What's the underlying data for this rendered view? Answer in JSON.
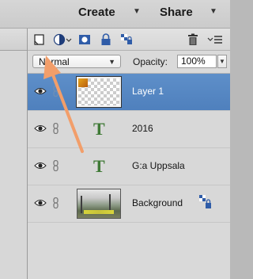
{
  "topbar": {
    "create_label": "Create",
    "share_label": "Share"
  },
  "panel": {
    "blend_mode": "Normal",
    "opacity_label": "Opacity:",
    "opacity_value": "100%",
    "layers": [
      {
        "name": "Layer 1",
        "type": "pixel",
        "selected": true
      },
      {
        "name": "2016",
        "type": "text",
        "selected": false
      },
      {
        "name": "G:a Uppsala",
        "type": "text",
        "selected": false
      },
      {
        "name": "Background",
        "type": "photo",
        "selected": false,
        "locked": true
      }
    ]
  },
  "icons": [
    "new-layer-icon",
    "adjustment-layer-icon",
    "layer-mask-icon",
    "lock-all-icon",
    "lock-transparency-icon",
    "delete-layer-icon",
    "panel-menu-icon"
  ],
  "colors": {
    "selection": "#5e8fc9",
    "annotation_arrow": "#f29e6a",
    "text_layer": "#3f7a36"
  }
}
